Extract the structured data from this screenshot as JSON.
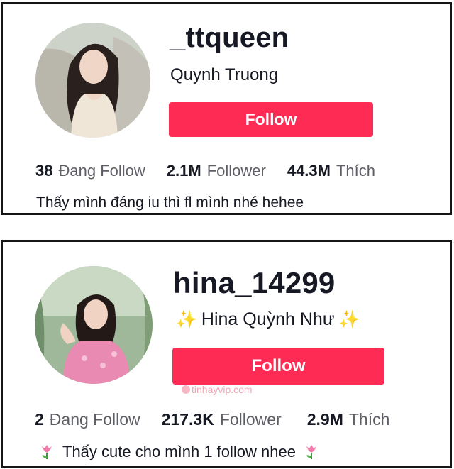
{
  "profiles": [
    {
      "username": "_ttqueen",
      "nickname": "Quynh Truong",
      "follow_label": "Follow",
      "stats": [
        {
          "value": "38",
          "label": "Đang Follow"
        },
        {
          "value": "2.1M",
          "label": "Follower"
        },
        {
          "value": "44.3M",
          "label": "Thích"
        }
      ],
      "bio": "Thấy mình đáng iu thì fl mình nhé hehee"
    },
    {
      "username": "hina_14299",
      "nickname": "Hina Quỳnh Như",
      "nickname_decoration": "✨",
      "follow_label": "Follow",
      "stats": [
        {
          "value": "2",
          "label": "Đang Follow"
        },
        {
          "value": "217.3K",
          "label": "Follower"
        },
        {
          "value": "2.9M",
          "label": "Thích"
        }
      ],
      "bio": "Thấy cute cho mình 1 follow nhee",
      "bio_decoration_icon": "tulip-icon"
    }
  ],
  "watermark": "tinhayvip.com",
  "colors": {
    "follow_button": "#fe2c55",
    "text_primary": "#161823",
    "text_secondary": "#5e5f66",
    "card_border": "#161616"
  }
}
